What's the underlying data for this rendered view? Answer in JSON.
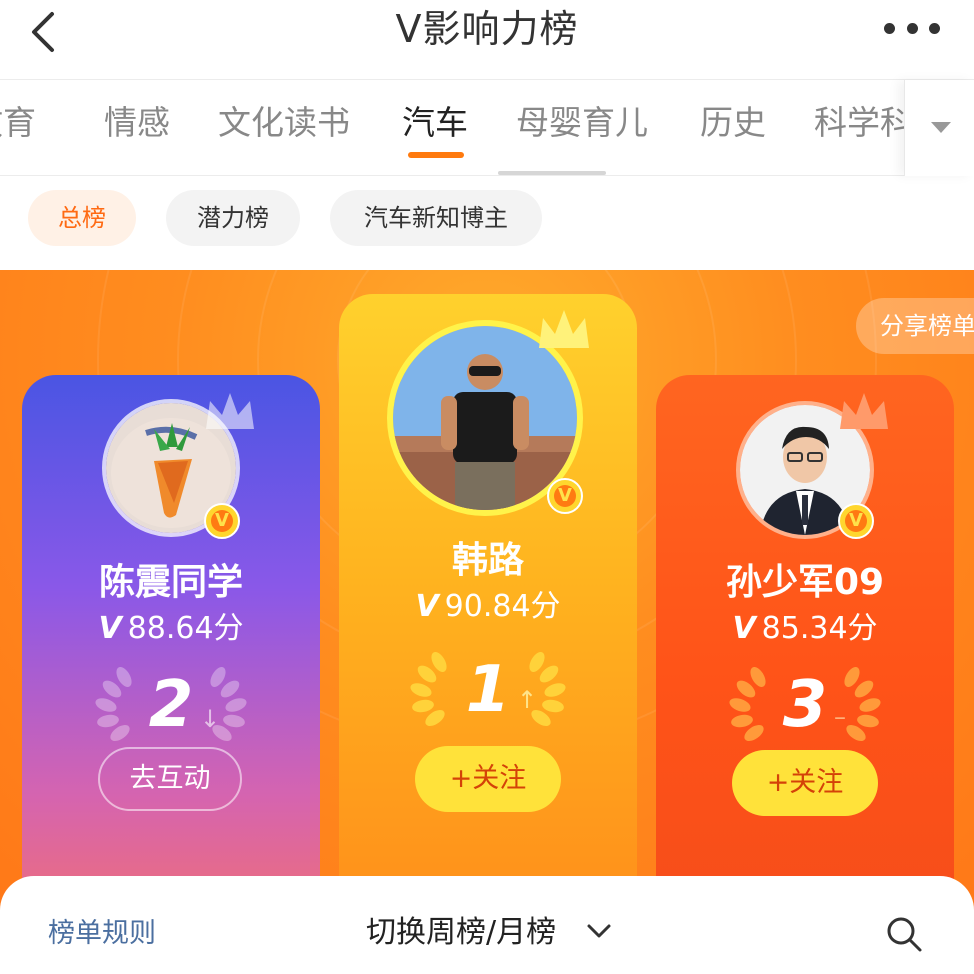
{
  "header": {
    "title": "V影响力榜",
    "back_icon": "chevron-left-icon",
    "more_icon": "more-icon"
  },
  "tabs": [
    {
      "label": "教育"
    },
    {
      "label": "情感"
    },
    {
      "label": "文化读书"
    },
    {
      "label": "汽车",
      "active": true
    },
    {
      "label": "母婴育儿"
    },
    {
      "label": "历史"
    },
    {
      "label": "科学科"
    }
  ],
  "filters": [
    {
      "label": "总榜",
      "active": true
    },
    {
      "label": "潜力榜"
    },
    {
      "label": "汽车新知博主"
    }
  ],
  "share_label": "分享榜单",
  "podium": [
    {
      "rank": "2",
      "trend": "↓",
      "name": "陈震同学",
      "v_mark": "V",
      "score": "88.64分",
      "button": "去互动",
      "followed": true
    },
    {
      "rank": "1",
      "trend": "↑",
      "name": "韩路",
      "v_mark": "V",
      "score": "90.84分",
      "button": "+关注",
      "followed": false
    },
    {
      "rank": "3",
      "trend": "–",
      "name": "孙少军09",
      "v_mark": "V",
      "score": "85.34分",
      "button": "+关注",
      "followed": false
    }
  ],
  "footer": {
    "rules": "榜单规则",
    "switch": "切换周榜/月榜",
    "search_icon": "search-icon"
  },
  "colors": {
    "accent": "#ff7a0e",
    "follow_bg": "#ffe23a",
    "follow_text": "#d44208",
    "link": "#4b6fa0"
  }
}
